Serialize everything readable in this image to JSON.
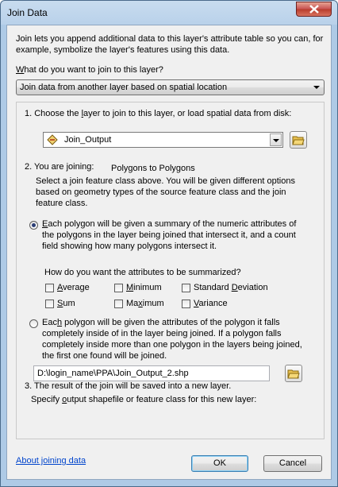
{
  "window": {
    "title": "Join Data"
  },
  "intro": "Join lets you append additional data to this layer's attribute table so you can, for example, symbolize the layer's features using this data.",
  "question": {
    "prefix": "W",
    "rest": "hat do you want to join to this layer?"
  },
  "join_type": {
    "selected": "Join data from another layer based on spatial location"
  },
  "step1": {
    "pre": "1.  Choose the ",
    "u": "l",
    "post": "ayer to join to this layer, or load spatial data from disk:"
  },
  "layer_select": {
    "value": "Join_Output"
  },
  "step2": {
    "label": "2.  You are joining:",
    "joining_value": "Polygons to Polygons",
    "description": "Select a join feature class above.  You will be given different options based on geometry types of the source feature class and the join feature class."
  },
  "option1": {
    "u": "E",
    "text": "ach polygon will be given a summary of the numeric attributes of the polygons in the layer being joined that intersect it, and a count field showing how many polygons intersect it."
  },
  "summarize_question": "How do you want the attributes to be summarized?",
  "summaries": [
    {
      "u": "A",
      "rest": "verage"
    },
    {
      "u": "M",
      "rest": "inimum"
    },
    {
      "pre": "Standard ",
      "u": "D",
      "rest": "eviation"
    },
    {
      "u": "S",
      "rest": "um"
    },
    {
      "pre": "Ma",
      "u": "x",
      "rest": "imum"
    },
    {
      "u": "V",
      "rest": "ariance"
    }
  ],
  "option2": {
    "pre": "Eac",
    "u": "h",
    "text": " polygon will be given the attributes of the polygon it falls completely inside of in the layer being joined. If a polygon falls completely inside more than one polygon in the layers being joined, the first one found will be joined."
  },
  "step3": {
    "label": "3.  The result of the join will be saved into a new layer.",
    "specify_pre": "Specify ",
    "specify_u": "o",
    "specify_post": "utput shapefile or feature class for this new layer:"
  },
  "output_path": "D:\\login_name\\PPA\\Join_Output_2.shp",
  "footer": {
    "help_link": "About joining data",
    "ok": "OK",
    "cancel": "Cancel"
  },
  "colors": {
    "accent": "#2a3d75",
    "link": "#0044cc",
    "close": "#c75050"
  }
}
